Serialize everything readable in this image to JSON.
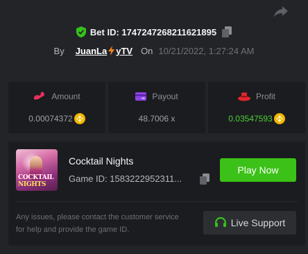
{
  "bet": {
    "label": "Bet ID:",
    "id": "1747247268211621895"
  },
  "meta": {
    "by_label": "By",
    "user_part1": "JuanLa",
    "user_part2": "yTV",
    "on_label": "On",
    "date": "10/21/2022, 1:27:24 AM"
  },
  "stats": {
    "amount_label": "Amount",
    "amount_value": "0.00074372",
    "payout_label": "Payout",
    "payout_value": "48.7006 x",
    "profit_label": "Profit",
    "profit_value": "0.03547593"
  },
  "game": {
    "title": "Cocktail Nights",
    "id_label": "Game ID:",
    "id_value": "1583222952311...",
    "thumb_line1": "COCKTAIL",
    "thumb_line2": "NIGHTS",
    "play_label": "Play Now"
  },
  "support": {
    "help_text": "Any issues, please contact the customer service for help and provide the game ID.",
    "button_label": "Live Support"
  },
  "colors": {
    "background": "#232428",
    "panel": "#1b1c1f",
    "accent_green": "#3bc117",
    "profit_green": "#4cd137",
    "coin_gold": "#f2b705"
  },
  "icons": {
    "share": "share-arrow-icon",
    "verified": "shield-check-icon",
    "copy": "copy-icon",
    "bolt": "lightning-bolt-icon",
    "amount": "bet-amount-icon",
    "payout": "wallet-card-icon",
    "profit": "hat-icon",
    "coin": "bnb-coin-icon",
    "headset": "headset-icon"
  }
}
